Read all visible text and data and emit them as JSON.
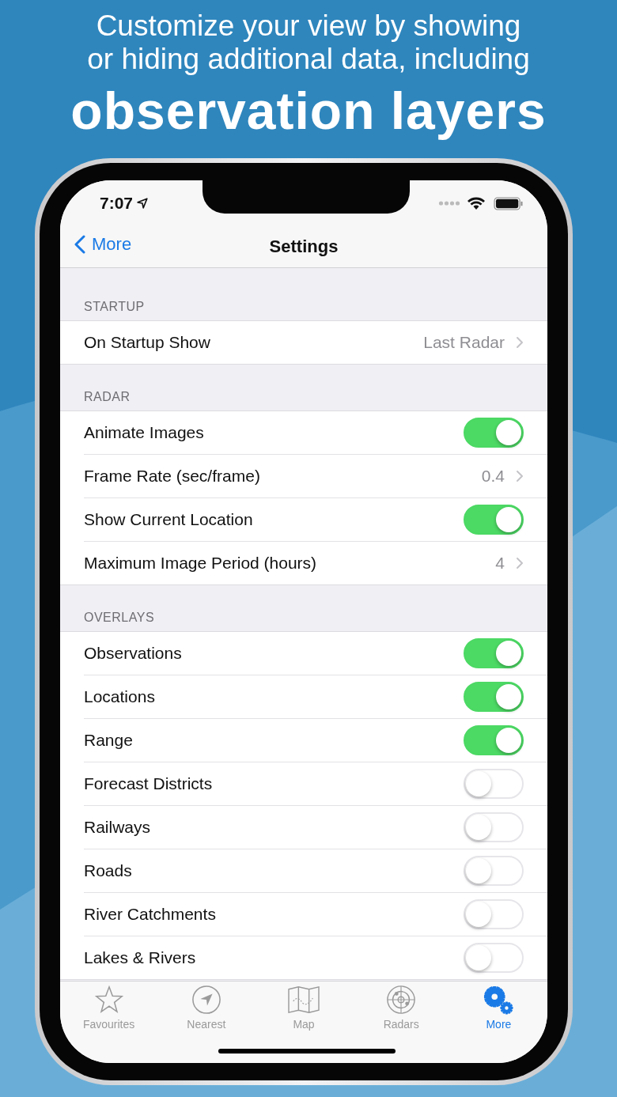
{
  "headline": {
    "lines": [
      "Customize your view by showing",
      "or hiding additional data, including"
    ],
    "emphasis": "observation layers"
  },
  "status_bar": {
    "time": "7:07"
  },
  "nav": {
    "back": "More",
    "title": "Settings"
  },
  "sections": [
    {
      "header": "STARTUP",
      "rows": [
        {
          "kind": "value",
          "label": "On Startup Show",
          "value": "Last Radar"
        }
      ]
    },
    {
      "header": "RADAR",
      "rows": [
        {
          "kind": "toggle",
          "label": "Animate Images",
          "on": true
        },
        {
          "kind": "value",
          "label": "Frame Rate (sec/frame)",
          "value": "0.4"
        },
        {
          "kind": "toggle",
          "label": "Show Current Location",
          "on": true
        },
        {
          "kind": "value",
          "label": "Maximum Image Period (hours)",
          "value": "4"
        }
      ]
    },
    {
      "header": "OVERLAYS",
      "rows": [
        {
          "kind": "toggle",
          "label": "Observations",
          "on": true
        },
        {
          "kind": "toggle",
          "label": "Locations",
          "on": true
        },
        {
          "kind": "toggle",
          "label": "Range",
          "on": true
        },
        {
          "kind": "toggle",
          "label": "Forecast Districts",
          "on": false
        },
        {
          "kind": "toggle",
          "label": "Railways",
          "on": false
        },
        {
          "kind": "toggle",
          "label": "Roads",
          "on": false
        },
        {
          "kind": "toggle",
          "label": "River Catchments",
          "on": false
        },
        {
          "kind": "toggle",
          "label": "Lakes & Rivers",
          "on": false
        }
      ]
    }
  ],
  "tabs": [
    {
      "kind": "star",
      "label": "Favourites",
      "selected": false
    },
    {
      "kind": "nearest",
      "label": "Nearest",
      "selected": false
    },
    {
      "kind": "map",
      "label": "Map",
      "selected": false
    },
    {
      "kind": "radar",
      "label": "Radars",
      "selected": false
    },
    {
      "kind": "gears",
      "label": "More",
      "selected": true
    }
  ]
}
